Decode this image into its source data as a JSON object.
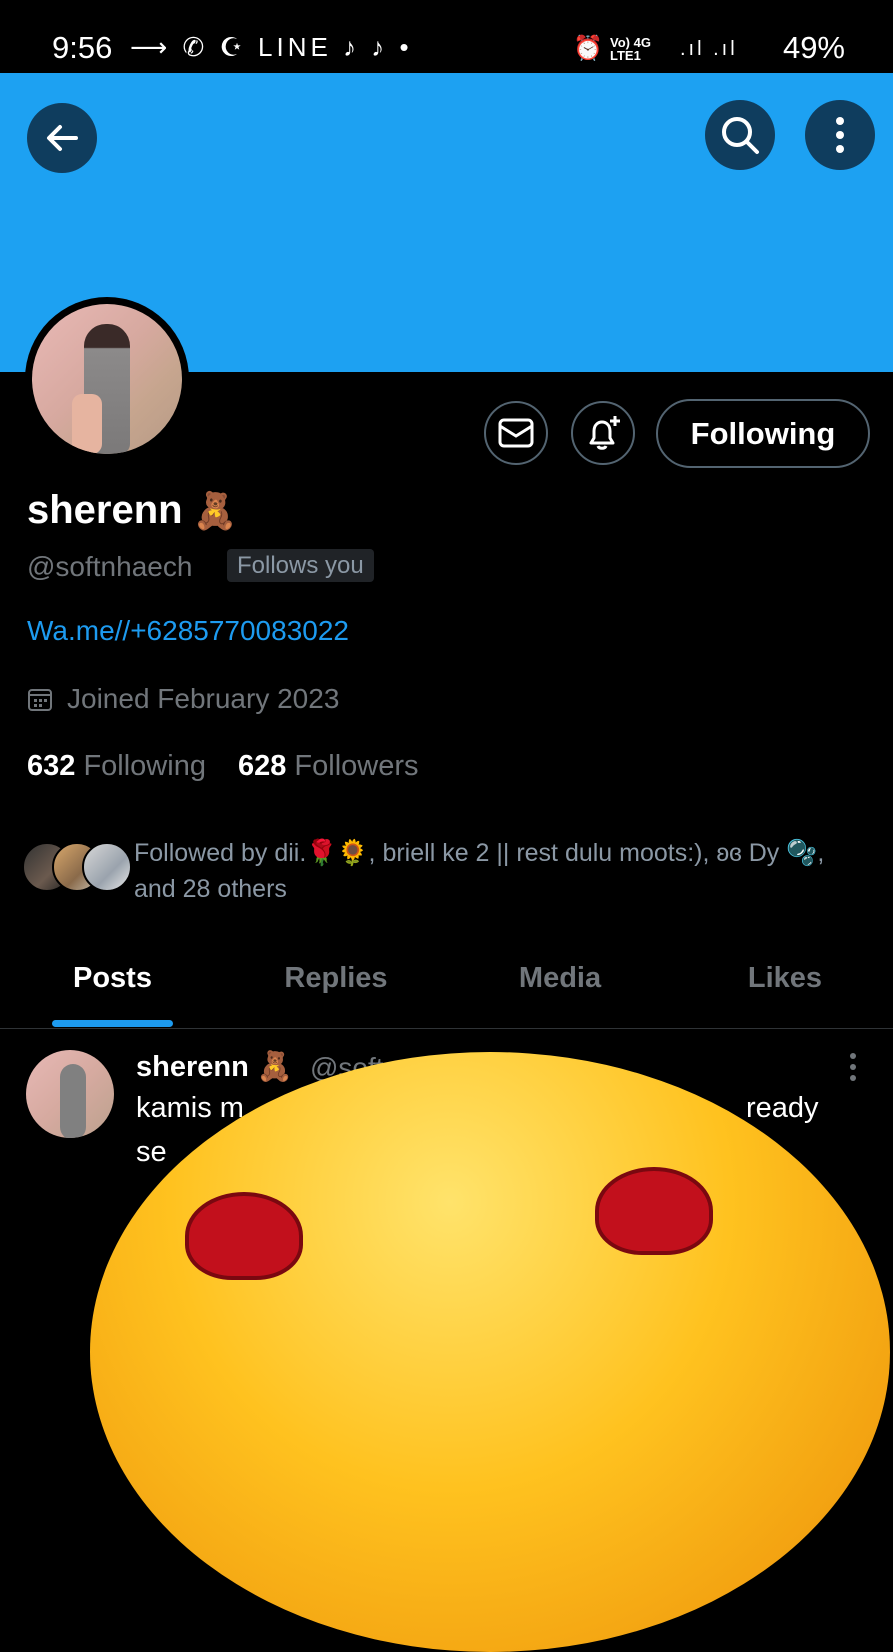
{
  "status_bar": {
    "time": "9:56",
    "left_icons": "⟶ ✆ ☪ LINE ♪ ♪ •",
    "network": "Vo) 4G\nLTE1",
    "battery": "49%"
  },
  "header": {
    "back_icon": "arrow-left-icon",
    "search_icon": "search-icon",
    "more_icon": "more-vertical-icon",
    "banner_color": "#1da1f2"
  },
  "profile": {
    "display_name": "sherenn",
    "name_emoji": "🧸",
    "handle": "@softnhaech",
    "follows_you": "Follows you",
    "link": "Wa.me//+6285770083022",
    "joined": "Joined February 2023",
    "following_count": "632",
    "following_label": "Following",
    "followers_count": "628",
    "followers_label": "Followers",
    "followed_by": "Followed by dii.🌹🌻, briell ke 2 || rest dulu moots:), ʚɞ Dy 🫧, and 28 others"
  },
  "actions": {
    "message_icon": "mail-icon",
    "notify_icon": "bell-plus-icon",
    "follow_label": "Following"
  },
  "tabs": [
    {
      "label": "Posts",
      "active": true
    },
    {
      "label": "Replies",
      "active": false
    },
    {
      "label": "Media",
      "active": false
    },
    {
      "label": "Likes",
      "active": false
    }
  ],
  "post": {
    "name": "sherenn",
    "name_emoji": "🧸",
    "handle": "@soft",
    "text_start": "kamis m",
    "text_end": "ready",
    "text_line2": "se"
  },
  "colors": {
    "accent": "#1d9bf0",
    "muted": "#71767b",
    "background": "#000000"
  }
}
